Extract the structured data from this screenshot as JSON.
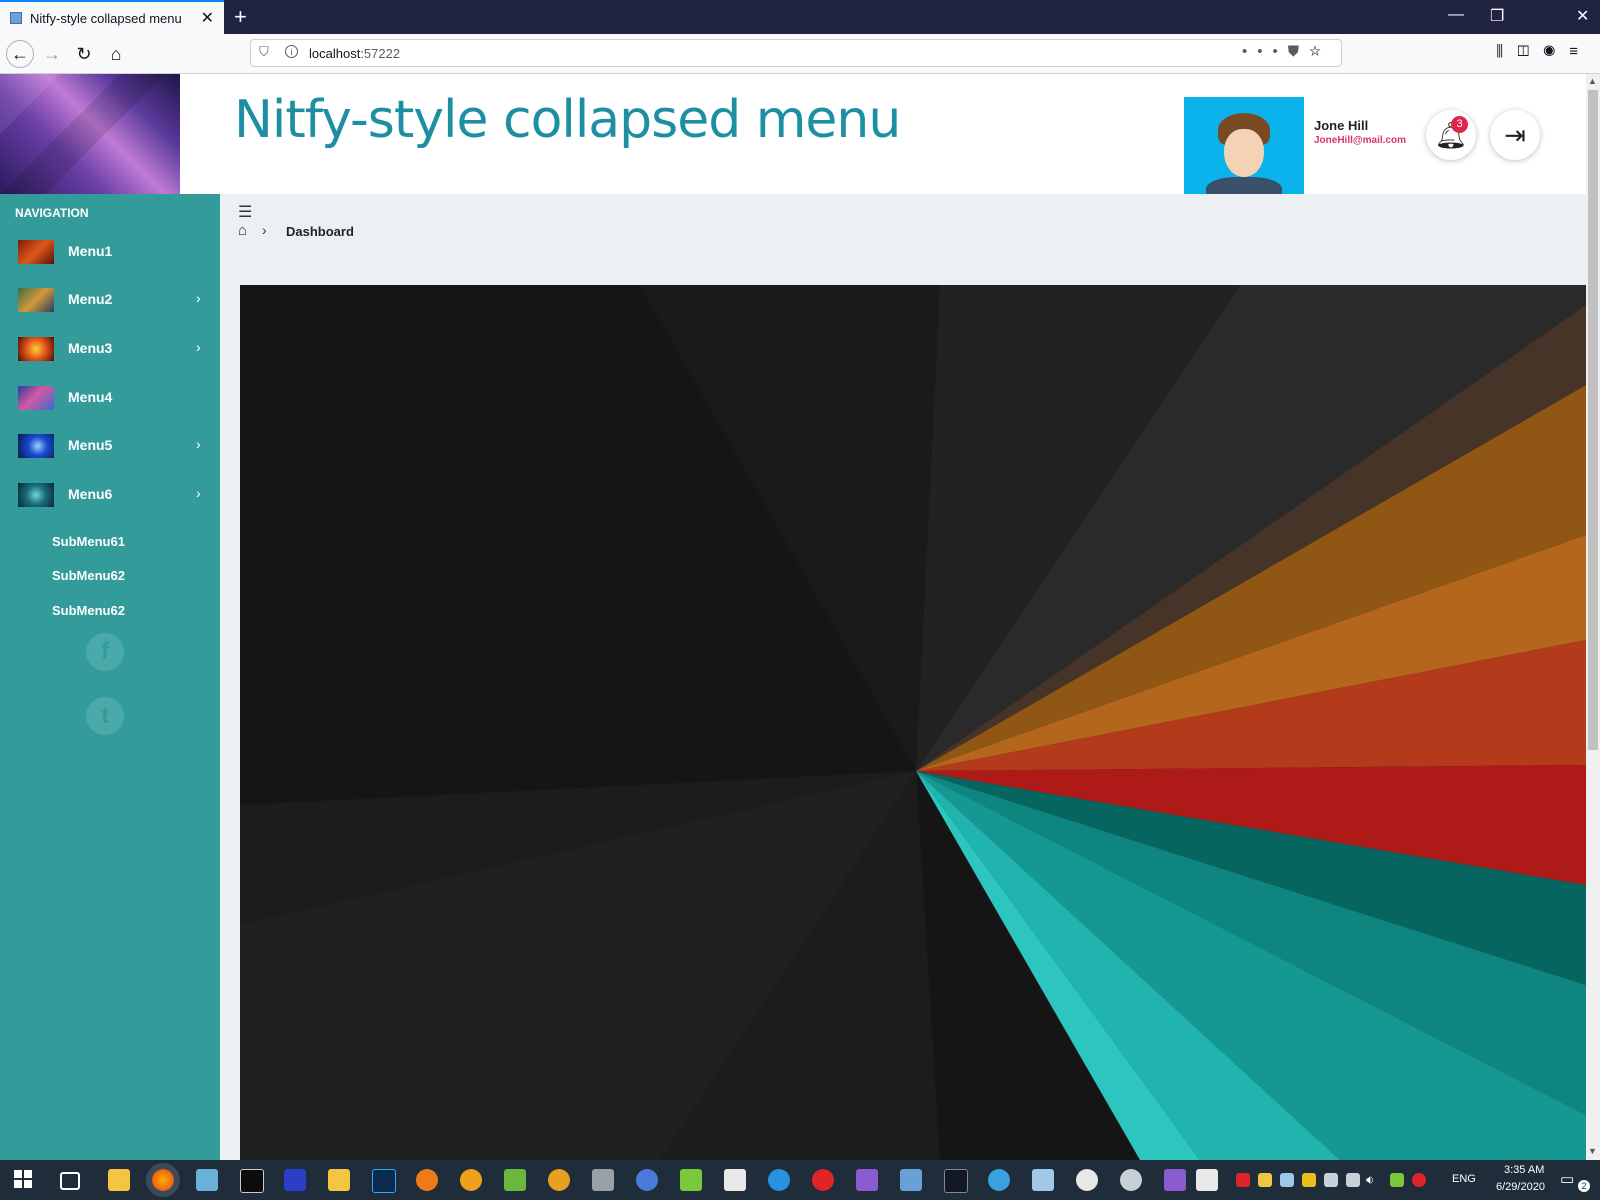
{
  "browser": {
    "tab_title": "Nitfy-style collapsed menu",
    "tab_close": "✕",
    "new_tab": "+",
    "url_host": "localhost",
    "url_port": ":57222",
    "window": {
      "minimize": "—",
      "restore": "❐",
      "close": "✕"
    }
  },
  "header": {
    "title": "Nitfy-style collapsed menu",
    "user_name": "Jone Hill",
    "user_email": "JoneHill@mail.com",
    "notifications_count": "3"
  },
  "sidebar": {
    "heading": "NAVIGATION",
    "items": [
      {
        "label": "Menu1",
        "has_children": false
      },
      {
        "label": "Menu2",
        "has_children": true
      },
      {
        "label": "Menu3",
        "has_children": true
      },
      {
        "label": "Menu4",
        "has_children": false
      },
      {
        "label": "Menu5",
        "has_children": true
      },
      {
        "label": "Menu6",
        "has_children": true
      }
    ],
    "submenu": [
      "SubMenu61",
      "SubMenu62",
      "SubMenu62"
    ],
    "social": [
      "f",
      "t"
    ]
  },
  "breadcrumb": {
    "current": "Dashboard"
  },
  "taskbar": {
    "time": "3:35 AM",
    "date": "6/29/2020",
    "language": "ENG",
    "notifications": "2"
  },
  "colors": {
    "sidebar": "#349b9b",
    "title": "#1e8fa3",
    "badge": "#e1244a",
    "email": "#d6336c",
    "user_card": "#0ab3ec"
  }
}
